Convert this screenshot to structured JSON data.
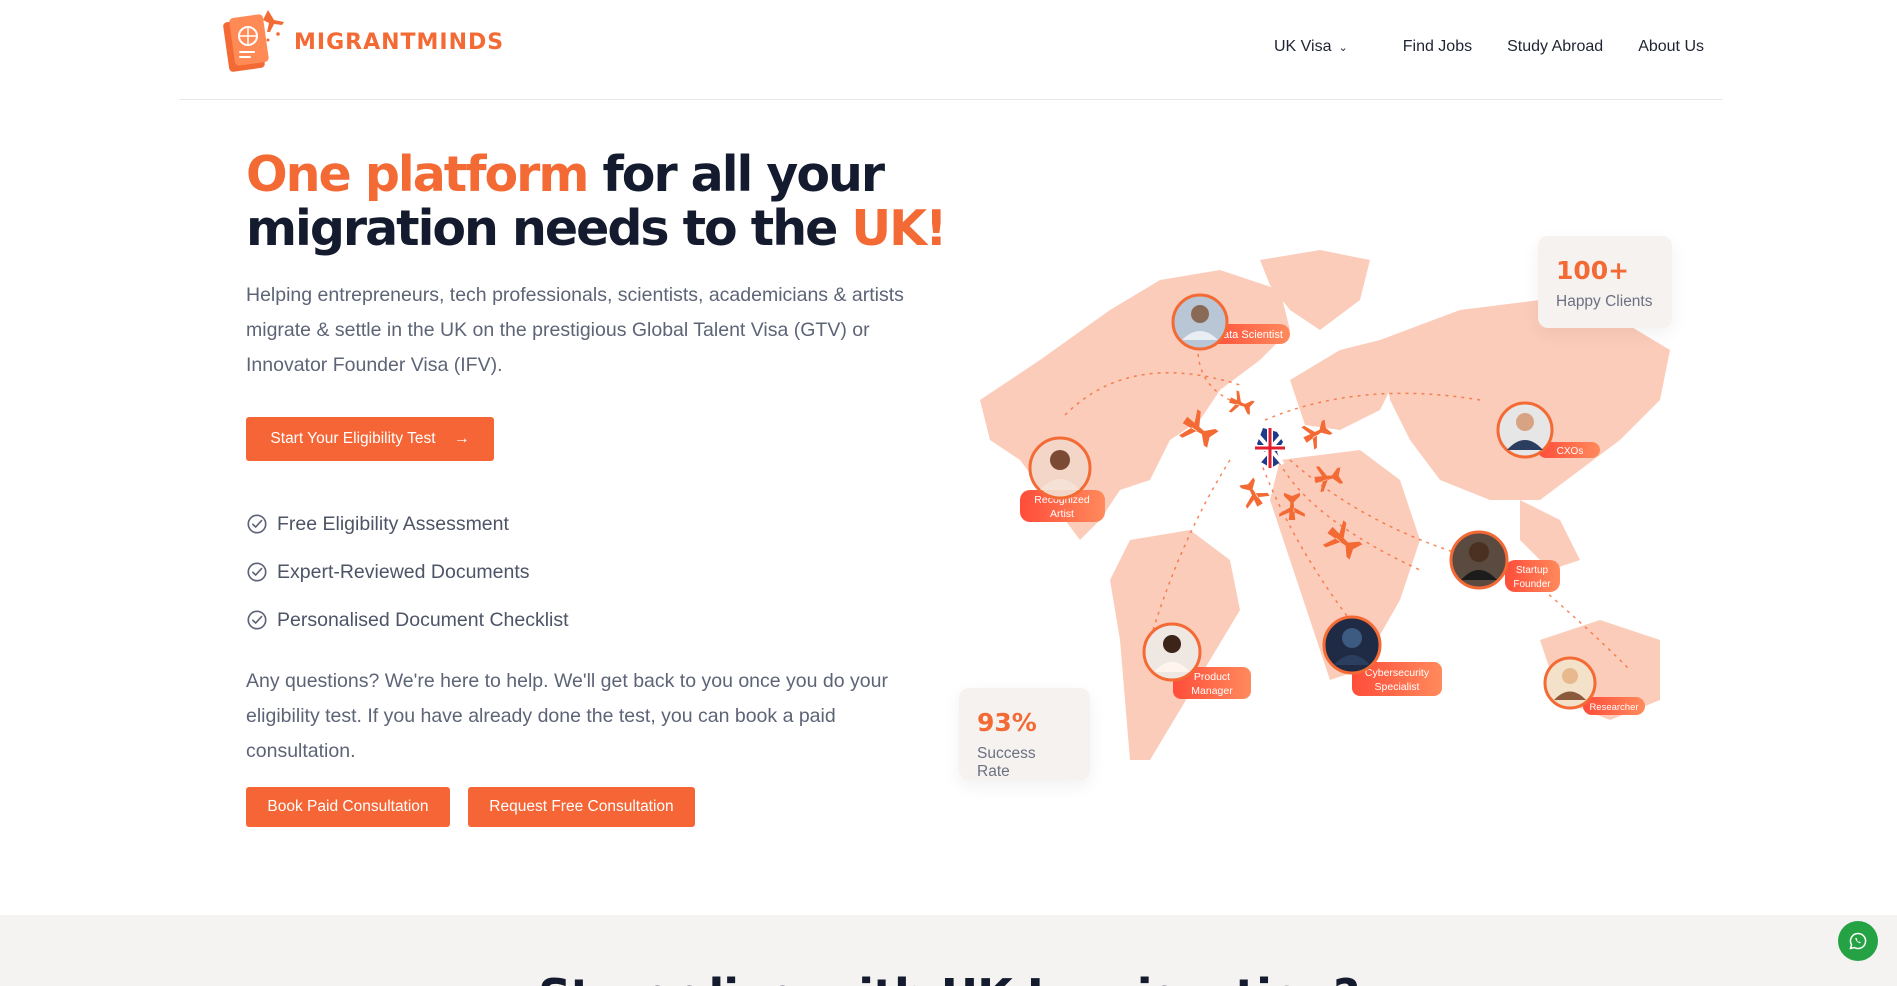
{
  "header": {
    "brand": "MIGRANTMINDS",
    "nav": [
      {
        "label": "UK Visa",
        "has_dropdown": true
      },
      {
        "label": "Find Jobs"
      },
      {
        "label": "Study Abroad"
      },
      {
        "label": "About Us"
      }
    ]
  },
  "hero": {
    "title_accent_1": "One platform",
    "title_mid": " for all your migration needs to the ",
    "title_accent_2": "UK!",
    "subtitle": "Helping entrepreneurs, tech professionals, scientists, academicians & artists migrate & settle in the UK on the prestigious Global Talent Visa (GTV) or Innovator Founder Visa (IFV).",
    "cta_label": "Start Your Eligibility Test",
    "features": [
      "Free Eligibility Assessment",
      "Expert-Reviewed Documents",
      "Personalised Document Checklist"
    ],
    "help_text": "Any questions? We're here to help. We'll get back to you once you do your eligibility test. If you have already done the test, you can book a paid consultation.",
    "paid_label": "Book Paid Consultation",
    "free_label": "Request Free Consultation"
  },
  "map": {
    "labels": {
      "data_scientist": "Data Scientist",
      "cxos": "CXOs",
      "recognized_artist_1": "Recognized",
      "recognized_artist_2": "Artist",
      "startup_founder_1": "Startup",
      "startup_founder_2": "Founder",
      "product_manager_1": "Product",
      "product_manager_2": "Manager",
      "cyber_1": "Cybersecurity",
      "cyber_2": "Specialist",
      "researcher": "Researcher"
    }
  },
  "stats": {
    "clients_value": "100+",
    "clients_label": "Happy Clients",
    "success_value": "93%",
    "success_label": "Success Rate"
  },
  "next_section": {
    "title": "Struggling with UK Immigration?"
  },
  "colors": {
    "accent": "#f46a35",
    "button": "#f66535",
    "heading": "#141b2e",
    "body_text": "#5d6476",
    "whatsapp": "#25a244"
  },
  "icons": [
    "passport-logo-icon",
    "chevron-down-icon",
    "arrow-right-icon",
    "check-circle-icon",
    "airplane-icon",
    "uk-flag-icon",
    "whatsapp-icon"
  ]
}
